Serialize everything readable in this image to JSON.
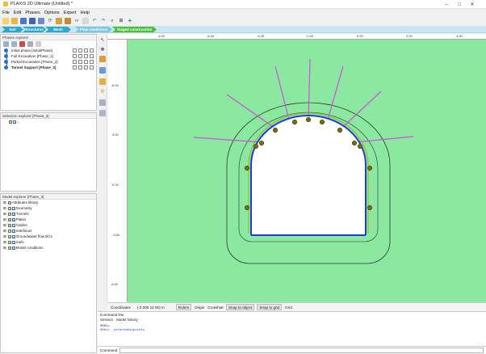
{
  "window": {
    "title": "PLAXIS 2D Ultimate (Untitled) *",
    "controls": [
      "–",
      "□",
      "✕"
    ]
  },
  "menu": [
    "File",
    "Edit",
    "Phases",
    "Options",
    "Expert",
    "Help"
  ],
  "toolbar_icons": [
    "new-file-icon",
    "open-folder-icon",
    "save-icon",
    "save-as-icon",
    "close-project-icon",
    "refresh-icon",
    "calculate-icon",
    "preview-icon",
    "link-icon",
    "document-icon",
    "undo-icon",
    "redo-icon",
    "zoom-icon",
    "zoom-fit-icon",
    "add-icon"
  ],
  "modes": [
    {
      "label": "Soil",
      "color": "#2fa7c8"
    },
    {
      "label": "Structures",
      "color": "#2fa7c8"
    },
    {
      "label": "Mesh",
      "color": "#2fa7c8"
    },
    {
      "label": "Flow conditions",
      "color": "#7cc8de"
    },
    {
      "label": "Staged construction",
      "color": "#4dbf3a"
    }
  ],
  "phases_explorer": {
    "title": "Phases explorer",
    "phases": [
      {
        "label": "Initial phase [InitialPhase]",
        "bold": false
      },
      {
        "label": "Full Excavation [Phase_1]",
        "bold": false
      },
      {
        "label": "Partial Excavation [Phase_2]",
        "bold": false
      },
      {
        "label": "Tunnel Support [Phase_3]",
        "bold": true
      }
    ]
  },
  "selection_explorer": {
    "title": "Selection explorer [Phase_3]",
    "items": [
      "..."
    ]
  },
  "model_explorer": {
    "title": "Model explorer [Phase_3]",
    "items": [
      "Attributes library",
      "Geometry",
      "Tunnels",
      "Plates",
      "Cables",
      "Interfaces",
      "Groundwater flow BCs",
      "Soils",
      "Model conditions"
    ]
  },
  "rulers": {
    "x_labels": [
      "-8.00",
      "-6.00",
      "-4.00",
      "-2.00",
      "0.00",
      "2.00",
      "4.00",
      "6.00",
      "8.00"
    ],
    "y_labels": [
      "6.00",
      "3.00",
      "0.00",
      "-3.00",
      "-6.00"
    ]
  },
  "statusbar": {
    "coordinates_label": "Coordinates",
    "coordinates_value": "(-2.000 12.00) m",
    "buttons": [
      "Rulers",
      "Origin",
      "Crosshair",
      "Snap to object",
      "Snap to grid",
      "Grid"
    ]
  },
  "command": {
    "title": "Command line",
    "tabs": [
      "Session",
      "Model history"
    ],
    "log": [
      "0001> ",
      "  ",
      "0002> _selectmeshpoints"
    ],
    "input_label": "Command"
  },
  "colors": {
    "canvas": "#8ae8a0",
    "lining": "#1a3fd0",
    "anchors": "#d24fd8",
    "contour": "#2a3a2a",
    "nodes": "#7a6a10"
  }
}
